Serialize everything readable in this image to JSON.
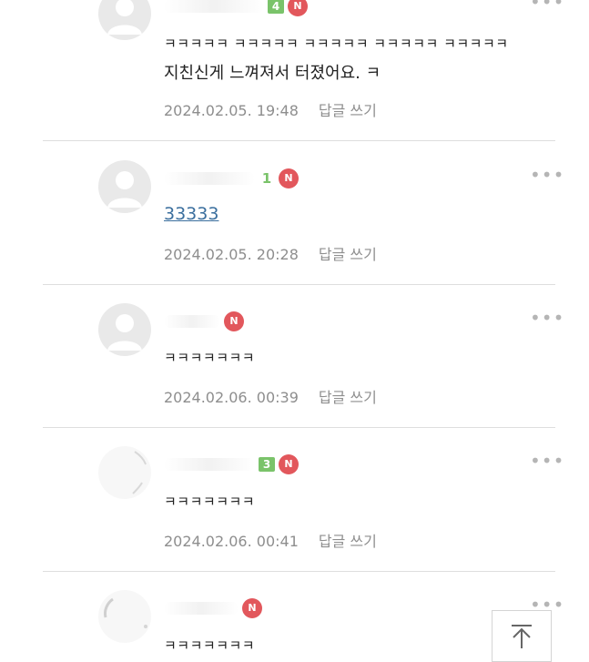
{
  "comments": [
    {
      "level": "4",
      "new_badge": "N",
      "text_line1": "ㅋㅋㅋㅋㅋ ㅋㅋㅋㅋㅋ ㅋㅋㅋㅋㅋ ㅋㅋㅋㅋㅋ ㅋㅋㅋㅋㅋ",
      "text_line2": "지친신게 느껴져서 터졌어요. ㅋ",
      "date": "2024.02.05. 19:48",
      "reply": "답글 쓰기"
    },
    {
      "level": "1",
      "new_badge": "N",
      "text": "33333",
      "date": "2024.02.05. 20:28",
      "reply": "답글 쓰기"
    },
    {
      "new_badge": "N",
      "text": "ㅋㅋㅋㅋㅋㅋㅋ",
      "date": "2024.02.06. 00:39",
      "reply": "답글 쓰기"
    },
    {
      "level": "3",
      "new_badge": "N",
      "text": "ㅋㅋㅋㅋㅋㅋㅋ",
      "date": "2024.02.06. 00:41",
      "reply": "답글 쓰기"
    },
    {
      "new_badge": "N",
      "text": "ㅋㅋㅋㅋㅋㅋㅋ"
    }
  ],
  "icons": {
    "more": "more-dots-icon",
    "top": "arrow-up-to-top-icon",
    "avatar": "default-profile-icon"
  },
  "colors": {
    "level_badge": "#7ac36a",
    "new_badge": "#e2575c",
    "link": "#3b6f9e",
    "meta": "#8e8e8e"
  }
}
